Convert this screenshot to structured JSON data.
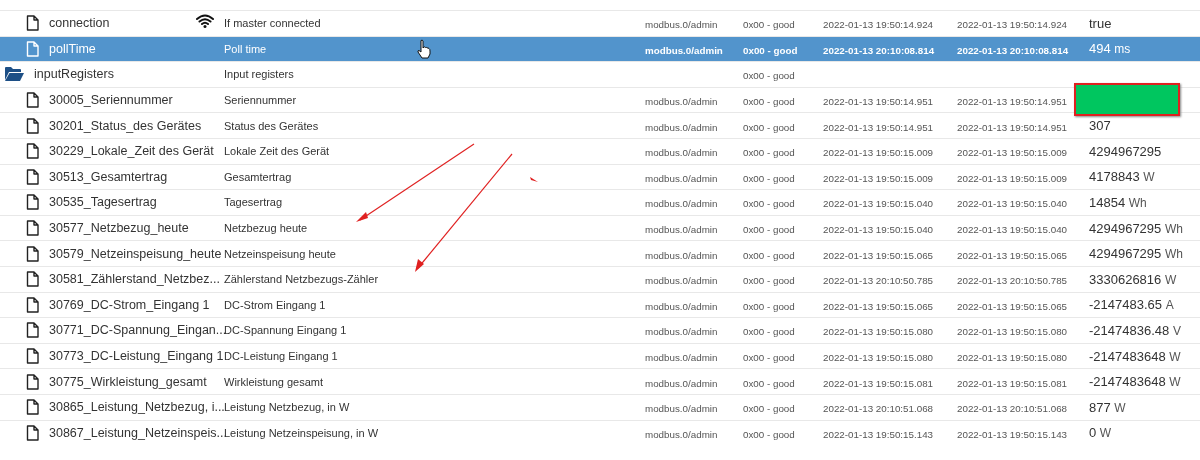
{
  "rows": [
    {
      "kind": "state",
      "selected": false,
      "has_icon": true,
      "name": "connection",
      "description": "If master connected",
      "role": "modbus.0/admin",
      "status": "0x00 - good",
      "ts": "2022-01-13 19:50:14.924",
      "lc": "2022-01-13 19:50:14.924",
      "value": "true",
      "unit": ""
    },
    {
      "kind": "state",
      "selected": true,
      "has_icon": false,
      "name": "pollTime",
      "description": "Poll time",
      "role": "modbus.0/admin",
      "status": "0x00 - good",
      "ts": "2022-01-13 20:10:08.814",
      "lc": "2022-01-13 20:10:08.814",
      "value": "494",
      "unit": "ms"
    },
    {
      "kind": "folder",
      "selected": false,
      "has_icon": false,
      "name": "inputRegisters",
      "description": "Input registers",
      "role": "",
      "status": "0x00 - good",
      "ts": "",
      "lc": "",
      "value": "",
      "unit": ""
    },
    {
      "kind": "state",
      "selected": false,
      "has_icon": false,
      "redacted": true,
      "name": "30005_Seriennummer",
      "description": "Seriennummer",
      "role": "modbus.0/admin",
      "status": "0x00 - good",
      "ts": "2022-01-13 19:50:14.951",
      "lc": "2022-01-13 19:50:14.951",
      "value": "",
      "unit": ""
    },
    {
      "kind": "state",
      "selected": false,
      "has_icon": false,
      "name": "30201_Status_des Gerätes",
      "description": "Status des Gerätes",
      "role": "modbus.0/admin",
      "status": "0x00 - good",
      "ts": "2022-01-13 19:50:14.951",
      "lc": "2022-01-13 19:50:14.951",
      "value": "307",
      "unit": ""
    },
    {
      "kind": "state",
      "selected": false,
      "has_icon": false,
      "name": "30229_Lokale_Zeit des Gerät",
      "description": "Lokale Zeit des Gerät",
      "role": "modbus.0/admin",
      "status": "0x00 - good",
      "ts": "2022-01-13 19:50:15.009",
      "lc": "2022-01-13 19:50:15.009",
      "value": "4294967295",
      "unit": ""
    },
    {
      "kind": "state",
      "selected": false,
      "has_icon": false,
      "name": "30513_Gesamtertrag",
      "description": "Gesamtertrag",
      "role": "modbus.0/admin",
      "status": "0x00 - good",
      "ts": "2022-01-13 19:50:15.009",
      "lc": "2022-01-13 19:50:15.009",
      "value": "4178843",
      "unit": "W"
    },
    {
      "kind": "state",
      "selected": false,
      "has_icon": false,
      "name": "30535_Tagesertrag",
      "description": "Tagesertrag",
      "role": "modbus.0/admin",
      "status": "0x00 - good",
      "ts": "2022-01-13 19:50:15.040",
      "lc": "2022-01-13 19:50:15.040",
      "value": "14854",
      "unit": "Wh"
    },
    {
      "kind": "state",
      "selected": false,
      "has_icon": false,
      "name": "30577_Netzbezug_heute",
      "description": "Netzbezug heute",
      "role": "modbus.0/admin",
      "status": "0x00 - good",
      "ts": "2022-01-13 19:50:15.040",
      "lc": "2022-01-13 19:50:15.040",
      "value": "4294967295",
      "unit": "Wh"
    },
    {
      "kind": "state",
      "selected": false,
      "has_icon": false,
      "name": "30579_Netzeinspeisung_heute",
      "description": "Netzeinspeisung heute",
      "role": "modbus.0/admin",
      "status": "0x00 - good",
      "ts": "2022-01-13 19:50:15.065",
      "lc": "2022-01-13 19:50:15.065",
      "value": "4294967295",
      "unit": "Wh"
    },
    {
      "kind": "state",
      "selected": false,
      "has_icon": false,
      "name": "30581_Zählerstand_Netzbez...",
      "description": "Zählerstand Netzbezugs-Zähler",
      "role": "modbus.0/admin",
      "status": "0x00 - good",
      "ts": "2022-01-13 20:10:50.785",
      "lc": "2022-01-13 20:10:50.785",
      "value": "3330626816",
      "unit": "W"
    },
    {
      "kind": "state",
      "selected": false,
      "has_icon": false,
      "name": "30769_DC-Strom_Eingang 1",
      "description": "DC-Strom Eingang 1",
      "role": "modbus.0/admin",
      "status": "0x00 - good",
      "ts": "2022-01-13 19:50:15.065",
      "lc": "2022-01-13 19:50:15.065",
      "value": "-2147483.65",
      "unit": "A"
    },
    {
      "kind": "state",
      "selected": false,
      "has_icon": false,
      "name": "30771_DC-Spannung_Eingan...",
      "description": "DC-Spannung Eingang 1",
      "role": "modbus.0/admin",
      "status": "0x00 - good",
      "ts": "2022-01-13 19:50:15.080",
      "lc": "2022-01-13 19:50:15.080",
      "value": "-21474836.48",
      "unit": "V"
    },
    {
      "kind": "state",
      "selected": false,
      "has_icon": false,
      "name": "30773_DC-Leistung_Eingang 1",
      "description": "DC-Leistung Eingang 1",
      "role": "modbus.0/admin",
      "status": "0x00 - good",
      "ts": "2022-01-13 19:50:15.080",
      "lc": "2022-01-13 19:50:15.080",
      "value": "-2147483648",
      "unit": "W"
    },
    {
      "kind": "state",
      "selected": false,
      "has_icon": false,
      "name": "30775_Wirkleistung_gesamt",
      "description": "Wirkleistung gesamt",
      "role": "modbus.0/admin",
      "status": "0x00 - good",
      "ts": "2022-01-13 19:50:15.081",
      "lc": "2022-01-13 19:50:15.081",
      "value": "-2147483648",
      "unit": "W"
    },
    {
      "kind": "state",
      "selected": false,
      "has_icon": false,
      "name": "30865_Leistung_Netzbezug, i...",
      "description": "Leistung Netzbezug, in W",
      "role": "modbus.0/admin",
      "status": "0x00 - good",
      "ts": "2022-01-13 20:10:51.068",
      "lc": "2022-01-13 20:10:51.068",
      "value": "877",
      "unit": "W"
    },
    {
      "kind": "state",
      "selected": false,
      "has_icon": false,
      "name": "30867_Leistung_Netzeinspeis...",
      "description": "Leistung Netzeinspeisung, in W",
      "role": "modbus.0/admin",
      "status": "0x00 - good",
      "ts": "2022-01-13 19:50:15.143",
      "lc": "2022-01-13 19:50:15.143",
      "value": "0",
      "unit": "W"
    }
  ]
}
